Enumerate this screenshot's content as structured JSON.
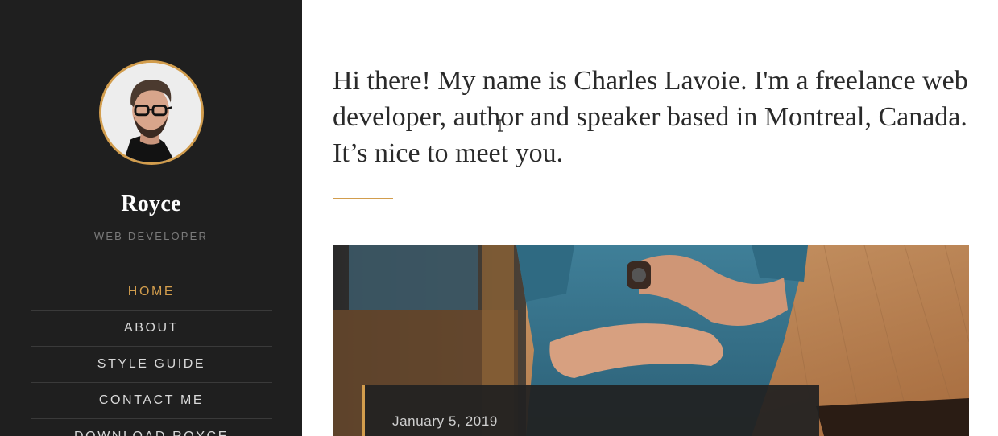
{
  "sidebar": {
    "title": "Royce",
    "subtitle": "WEB DEVELOPER",
    "nav": [
      {
        "label": "HOME",
        "active": true
      },
      {
        "label": "ABOUT"
      },
      {
        "label": "STYLE GUIDE"
      },
      {
        "label": "CONTACT ME"
      },
      {
        "label": "DOWNLOAD ROYCE"
      }
    ]
  },
  "main": {
    "intro": "Hi there! My name is Charles Lavoie. I'm a freelance web developer, author and speaker based in Montreal, Canada. It’s nice to meet you.",
    "featured_post": {
      "date": "January 5, 2019"
    }
  },
  "colors": {
    "accent": "#d29d4d",
    "sidebar_bg": "#1f1f1f"
  },
  "icons": {
    "cursor": "text-cursor-icon"
  }
}
